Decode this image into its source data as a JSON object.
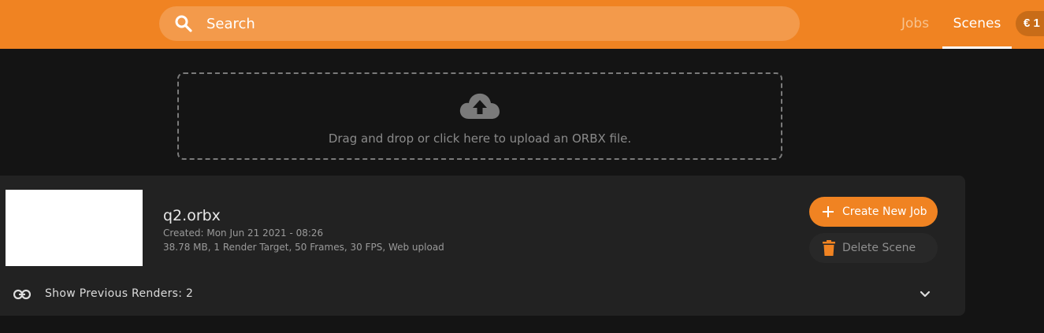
{
  "header": {
    "search_placeholder": "Search",
    "nav": [
      {
        "label": "Jobs",
        "active": false
      },
      {
        "label": "Scenes",
        "active": true
      }
    ],
    "balance": "€ 1"
  },
  "upload": {
    "text": "Drag and drop or click here to upload an ORBX file.",
    "icon": "cloud-upload-icon"
  },
  "scene": {
    "name": "q2.orbx",
    "created": "Created: Mon Jun 21 2021 - 08:26",
    "info": "38.78 MB, 1 Render Target, 50 Frames, 30 FPS, Web upload",
    "create_job_label": "Create New Job",
    "delete_label": "Delete Scene",
    "previous_renders_label": "Show Previous Renders: 2"
  },
  "colors": {
    "accent": "#f08322",
    "background": "#141414",
    "card": "#222222"
  }
}
